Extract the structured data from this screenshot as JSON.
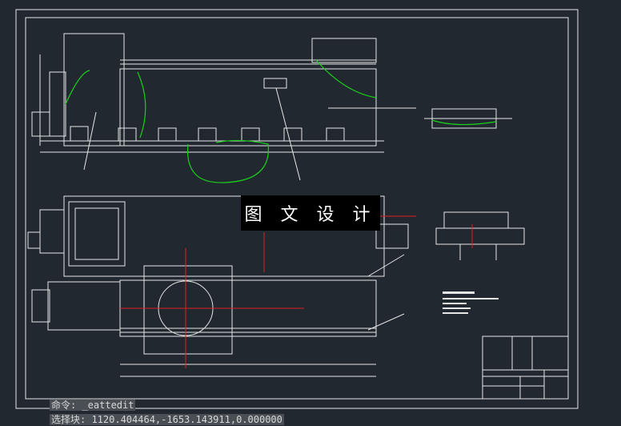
{
  "command_line": {
    "last_command": "命令: _eattedit",
    "prompt": "选择块: 1120.404464,-1653.143911,0.000000"
  },
  "watermark": "图 文 设 计",
  "colors": {
    "background": "#212830",
    "lines": "#e6e6e6",
    "green": "#19d219",
    "red": "#e02020",
    "cyan": "#40c0c0"
  }
}
